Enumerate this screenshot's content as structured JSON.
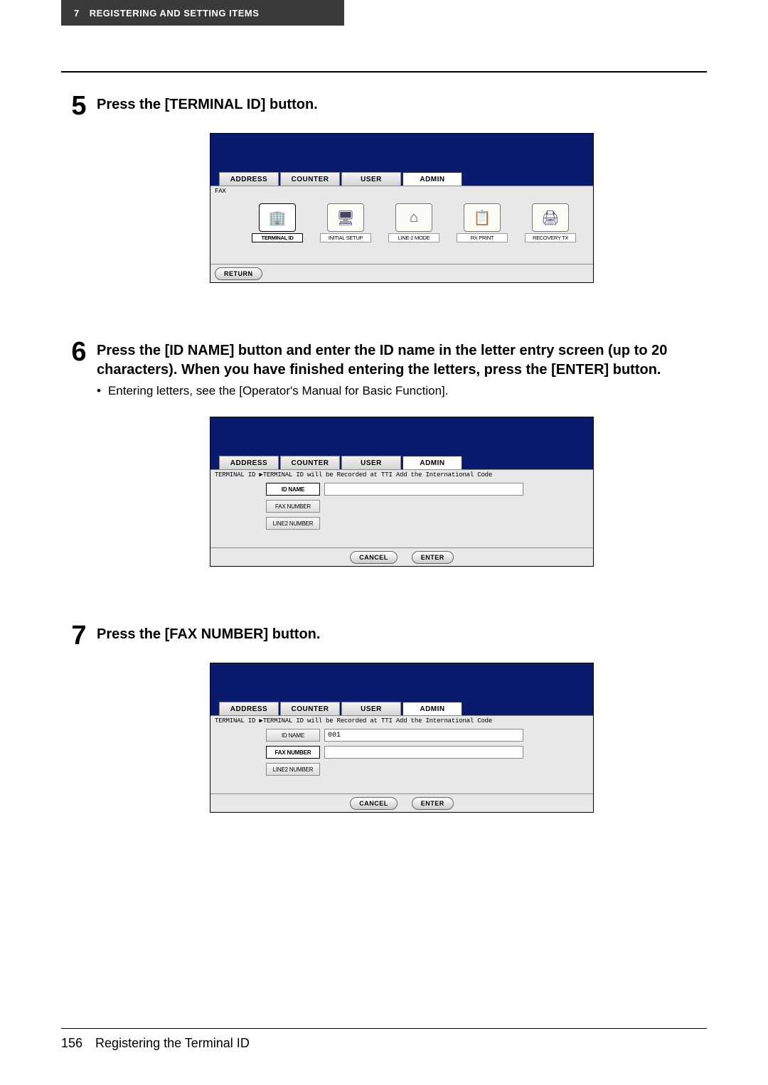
{
  "header": {
    "chapter_number": "7",
    "chapter_title": "REGISTERING AND SETTING ITEMS"
  },
  "steps": [
    {
      "number": "5",
      "heading": "Press the [TERMINAL ID] button.",
      "bullets": [],
      "screen": {
        "tabs": [
          "ADDRESS",
          "COUNTER",
          "USER",
          "ADMIN"
        ],
        "selected_tab": "ADMIN",
        "breadcrumb": "FAX",
        "icons": [
          {
            "label": "TERMINAL ID",
            "glyph": "🏢",
            "selected": true
          },
          {
            "label": "INITIAL SETUP",
            "glyph": "🖥",
            "selected": false
          },
          {
            "label": "LINE-2 MODE",
            "glyph": "⌂",
            "selected": false
          },
          {
            "label": "RX PRINT",
            "glyph": "📋",
            "selected": false
          },
          {
            "label": "RECOVERY TX",
            "glyph": "🖨",
            "selected": false
          }
        ],
        "footer_left": "RETURN"
      }
    },
    {
      "number": "6",
      "heading": "Press the [ID NAME] button and enter the ID name in the letter entry screen (up to 20 characters). When you have finished entering the letters, press the [ENTER] button.",
      "bullets": [
        "Entering letters, see the [Operator's Manual for Basic Function]."
      ],
      "screen": {
        "tabs": [
          "ADDRESS",
          "COUNTER",
          "USER",
          "ADMIN"
        ],
        "selected_tab": "ADMIN",
        "breadcrumb": "TERMINAL ID ▶TERMINAL ID will be Recorded at TTI Add the International Code",
        "fields": [
          {
            "label": "ID NAME",
            "selected": true,
            "value": ""
          },
          {
            "label": "FAX NUMBER",
            "selected": false,
            "value": ""
          },
          {
            "label": "LINE2 NUMBER",
            "selected": false,
            "value": ""
          }
        ],
        "footer_buttons": [
          "CANCEL",
          "ENTER"
        ]
      }
    },
    {
      "number": "7",
      "heading": "Press the [FAX NUMBER] button.",
      "bullets": [],
      "screen": {
        "tabs": [
          "ADDRESS",
          "COUNTER",
          "USER",
          "ADMIN"
        ],
        "selected_tab": "ADMIN",
        "breadcrumb": "TERMINAL ID ▶TERMINAL ID will be Recorded at TTI Add the International Code",
        "fields": [
          {
            "label": "ID NAME",
            "selected": false,
            "value": "001"
          },
          {
            "label": "FAX NUMBER",
            "selected": true,
            "value": ""
          },
          {
            "label": "LINE2 NUMBER",
            "selected": false,
            "value": ""
          }
        ],
        "footer_buttons": [
          "CANCEL",
          "ENTER"
        ]
      }
    }
  ],
  "footer": {
    "page_number": "156",
    "section_title": "Registering the Terminal ID"
  }
}
